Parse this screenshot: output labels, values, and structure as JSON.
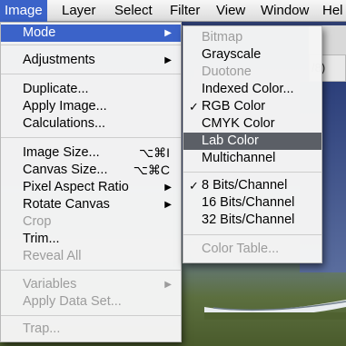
{
  "menubar": {
    "items": [
      "Image",
      "Layer",
      "Select",
      "Filter",
      "View",
      "Window",
      "Hel"
    ]
  },
  "document_tab": "/8)",
  "image_menu": {
    "items": [
      {
        "label": "Mode",
        "arrow": "▶",
        "state": "highlighted"
      },
      {
        "label": "Adjustments",
        "arrow": "▶"
      },
      {
        "label": "Duplicate..."
      },
      {
        "label": "Apply Image..."
      },
      {
        "label": "Calculations..."
      },
      {
        "label": "Image Size...",
        "shortcut": "⌥⌘I"
      },
      {
        "label": "Canvas Size...",
        "shortcut": "⌥⌘C"
      },
      {
        "label": "Pixel Aspect Ratio",
        "arrow": "▶"
      },
      {
        "label": "Rotate Canvas",
        "arrow": "▶"
      },
      {
        "label": "Crop",
        "state": "disabled"
      },
      {
        "label": "Trim..."
      },
      {
        "label": "Reveal All",
        "state": "disabled"
      },
      {
        "label": "Variables",
        "arrow": "▶",
        "state": "disabled"
      },
      {
        "label": "Apply Data Set...",
        "state": "disabled"
      },
      {
        "label": "Trap...",
        "state": "disabled"
      }
    ]
  },
  "mode_submenu": {
    "items": [
      {
        "label": "Bitmap",
        "state": "disabled"
      },
      {
        "label": "Grayscale"
      },
      {
        "label": "Duotone",
        "state": "disabled"
      },
      {
        "label": "Indexed Color..."
      },
      {
        "label": "RGB Color",
        "check": "✓"
      },
      {
        "label": "CMYK Color"
      },
      {
        "label": "Lab Color",
        "state": "highlighted"
      },
      {
        "label": "Multichannel"
      },
      {
        "label": "8 Bits/Channel",
        "check": "✓"
      },
      {
        "label": "16 Bits/Channel"
      },
      {
        "label": "32 Bits/Channel"
      },
      {
        "label": "Color Table...",
        "state": "disabled"
      }
    ]
  },
  "colors": {
    "highlight": "#3b63c9",
    "selected_gray": "#5b5f66",
    "disabled_text": "#9c9c9c"
  }
}
